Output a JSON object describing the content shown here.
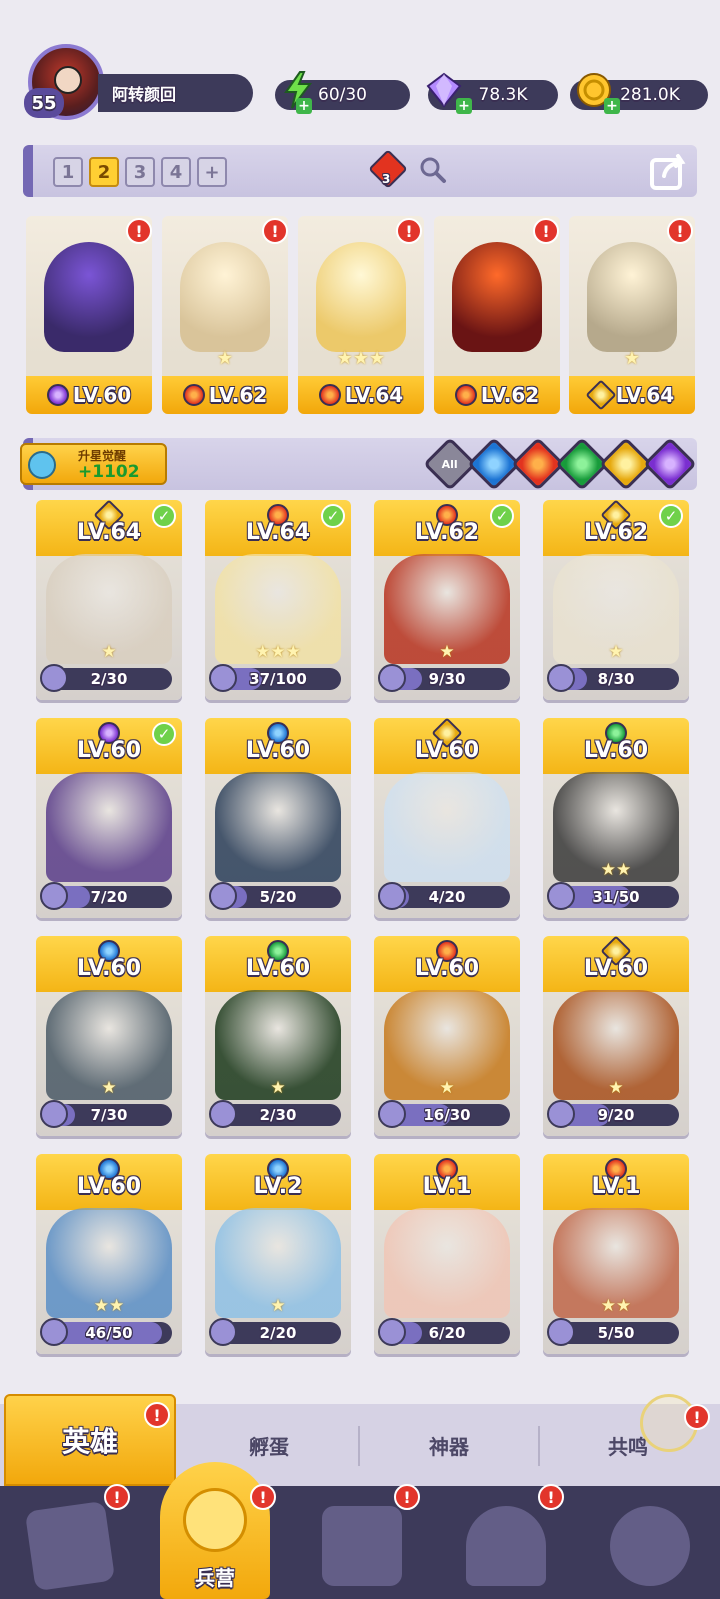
{
  "player": {
    "level": "55",
    "name": "阿转颜回"
  },
  "resources": [
    {
      "name": "energy",
      "icon": "lightning-icon",
      "value": "60/30"
    },
    {
      "name": "gems",
      "icon": "diamond-icon",
      "value": "78.3K"
    },
    {
      "name": "gold",
      "icon": "coin-icon",
      "value": "281.0K"
    }
  ],
  "team": {
    "tabs": [
      "1",
      "2",
      "3",
      "4",
      "+"
    ],
    "active_tab": "2",
    "badge_count": "3",
    "members": [
      {
        "element": "dark",
        "level": "LV.60",
        "stars": "",
        "alert": "!"
      },
      {
        "element": "fire",
        "level": "LV.62",
        "stars": "★",
        "alert": "!"
      },
      {
        "element": "fire",
        "level": "LV.64",
        "stars": "★★★",
        "alert": "!"
      },
      {
        "element": "fire",
        "level": "LV.62",
        "stars": "",
        "alert": "!"
      },
      {
        "element": "light",
        "level": "LV.64",
        "stars": "★",
        "alert": "!"
      }
    ]
  },
  "awaken": {
    "title": "升星觉醒",
    "value": "+1102"
  },
  "filters": {
    "all_label": "All"
  },
  "heroes": [
    {
      "element": "light",
      "level": "LV.64",
      "shards": "2/30",
      "progress": 0.07,
      "stars": "★",
      "checked": true
    },
    {
      "element": "fire",
      "level": "LV.64",
      "shards": "37/100",
      "progress": 0.37,
      "stars": "★★★",
      "checked": true
    },
    {
      "element": "fire",
      "level": "LV.62",
      "shards": "9/30",
      "progress": 0.3,
      "stars": "★",
      "checked": true
    },
    {
      "element": "light",
      "level": "LV.62",
      "shards": "8/30",
      "progress": 0.27,
      "stars": "★",
      "checked": true
    },
    {
      "element": "dark",
      "level": "LV.60",
      "shards": "7/20",
      "progress": 0.35,
      "stars": "",
      "checked": true
    },
    {
      "element": "water",
      "level": "LV.60",
      "shards": "5/20",
      "progress": 0.25,
      "stars": "",
      "checked": false
    },
    {
      "element": "light",
      "level": "LV.60",
      "shards": "4/20",
      "progress": 0.2,
      "stars": "",
      "checked": false
    },
    {
      "element": "wind",
      "level": "LV.60",
      "shards": "31/50",
      "progress": 0.62,
      "stars": "★★",
      "checked": false
    },
    {
      "element": "water",
      "level": "LV.60",
      "shards": "7/30",
      "progress": 0.23,
      "stars": "★",
      "checked": false
    },
    {
      "element": "wind",
      "level": "LV.60",
      "shards": "2/30",
      "progress": 0.07,
      "stars": "★",
      "checked": false
    },
    {
      "element": "fire",
      "level": "LV.60",
      "shards": "16/30",
      "progress": 0.53,
      "stars": "★",
      "checked": false
    },
    {
      "element": "light",
      "level": "LV.60",
      "shards": "9/20",
      "progress": 0.45,
      "stars": "★",
      "checked": false
    },
    {
      "element": "water",
      "level": "LV.60",
      "shards": "46/50",
      "progress": 0.92,
      "stars": "★★",
      "checked": false
    },
    {
      "element": "water",
      "level": "LV.2",
      "shards": "2/20",
      "progress": 0.1,
      "stars": "★",
      "checked": false
    },
    {
      "element": "fire",
      "level": "LV.1",
      "shards": "6/20",
      "progress": 0.3,
      "stars": "",
      "checked": false
    },
    {
      "element": "fire",
      "level": "LV.1",
      "shards": "5/50",
      "progress": 0.1,
      "stars": "★★",
      "checked": false
    }
  ],
  "subtabs": {
    "heroes": "英雄",
    "hatch": "孵蛋",
    "artifact": "神器",
    "resonance": "共鸣",
    "alert": "!"
  },
  "bottom_nav": {
    "active_label": "兵营",
    "alert": "!"
  }
}
